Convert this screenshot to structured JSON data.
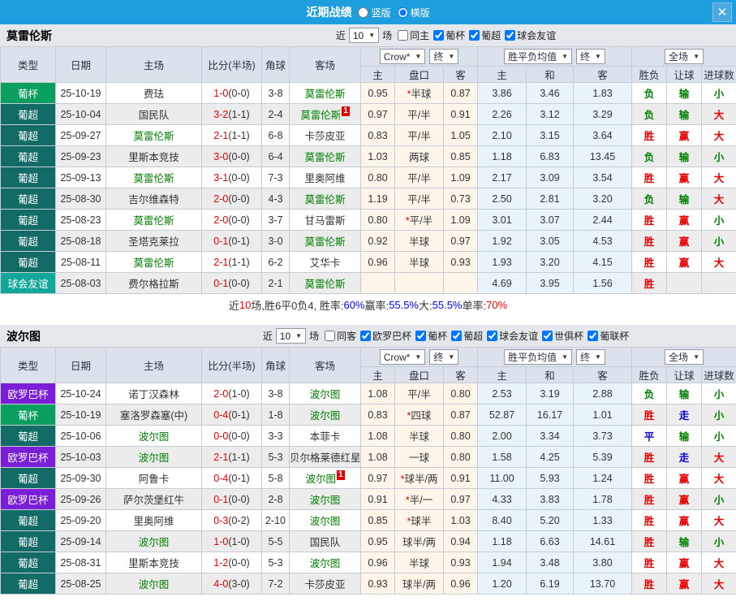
{
  "icons": {
    "dropdown_arrow": "▼"
  },
  "titlebar": {
    "title": "近期战绩",
    "vertical_label": "竖版",
    "horizontal_label": "横版",
    "selected": "横版",
    "close_label": "✕"
  },
  "header": {
    "cols": [
      "类型",
      "日期",
      "主场",
      "比分(半场)",
      "角球",
      "客场"
    ],
    "sub": [
      "主",
      "盘口",
      "客",
      "主",
      "和",
      "客",
      "胜负",
      "让球",
      "进球数"
    ],
    "dropdowns": {
      "crow": "Crow*",
      "final1": "终",
      "mean": "胜平负均值",
      "final2": "终",
      "full": "全场"
    }
  },
  "type_colors": {
    "葡杯": "#0a9f5e",
    "葡超": "#126b66",
    "球会友谊": "#13a69b",
    "欧罗巴杯": "#7a1ed8"
  },
  "result_colors": {
    "胜": "#e60000",
    "赢": "#e60000",
    "大": "#e60000",
    "负": "#008000",
    "输": "#008000",
    "小": "#008000",
    "平": "#0000dd",
    "走": "#0000dd"
  },
  "sections": [
    {
      "team": "莫雷伦斯",
      "filter": {
        "prefix": "近",
        "count": "10",
        "suffix": "场",
        "checkboxes": [
          {
            "label": "同主",
            "checked": false
          },
          {
            "label": "葡杯",
            "checked": true
          },
          {
            "label": "葡超",
            "checked": true
          },
          {
            "label": "球会友谊",
            "checked": true
          }
        ]
      },
      "rows": [
        {
          "type": "葡杯",
          "date": "25-10-19",
          "home": "费珐",
          "score": "1-0",
          "half": "(0-0)",
          "corners": "3-8",
          "away": "莫雷伦斯",
          "odds": [
            "0.95",
            "*半球",
            "0.87"
          ],
          "mean": [
            "3.86",
            "3.46",
            "1.83"
          ],
          "results": [
            "负",
            "输",
            "小"
          ]
        },
        {
          "type": "葡超",
          "date": "25-10-04",
          "home": "国民队",
          "score": "3-2",
          "half": "(1-1)",
          "corners": "2-4",
          "away": "莫雷伦斯",
          "away_badge": "1",
          "odds": [
            "0.97",
            "平/半",
            "0.91"
          ],
          "mean": [
            "2.26",
            "3.12",
            "3.29"
          ],
          "results": [
            "负",
            "输",
            "大"
          ]
        },
        {
          "type": "葡超",
          "date": "25-09-27",
          "home": "莫雷伦斯",
          "score": "2-1",
          "half": "(1-1)",
          "corners": "6-8",
          "away": "卡莎皮亚",
          "odds": [
            "0.83",
            "平/半",
            "1.05"
          ],
          "mean": [
            "2.10",
            "3.15",
            "3.64"
          ],
          "results": [
            "胜",
            "赢",
            "大"
          ]
        },
        {
          "type": "葡超",
          "date": "25-09-23",
          "home": "里斯本竞技",
          "score": "3-0",
          "half": "(0-0)",
          "corners": "6-4",
          "away": "莫雷伦斯",
          "odds": [
            "1.03",
            "两球",
            "0.85"
          ],
          "mean": [
            "1.18",
            "6.83",
            "13.45"
          ],
          "results": [
            "负",
            "输",
            "小"
          ]
        },
        {
          "type": "葡超",
          "date": "25-09-13",
          "home": "莫雷伦斯",
          "score": "3-1",
          "half": "(0-0)",
          "corners": "7-3",
          "away": "里奥阿维",
          "odds": [
            "0.80",
            "平/半",
            "1.09"
          ],
          "mean": [
            "2.17",
            "3.09",
            "3.54"
          ],
          "results": [
            "胜",
            "赢",
            "大"
          ]
        },
        {
          "type": "葡超",
          "date": "25-08-30",
          "home": "吉尔维森特",
          "score": "2-0",
          "half": "(0-0)",
          "corners": "4-3",
          "away": "莫雷伦斯",
          "odds": [
            "1.19",
            "平/半",
            "0.73"
          ],
          "mean": [
            "2.50",
            "2.81",
            "3.20"
          ],
          "results": [
            "负",
            "输",
            "大"
          ]
        },
        {
          "type": "葡超",
          "date": "25-08-23",
          "home": "莫雷伦斯",
          "score": "2-0",
          "half": "(0-0)",
          "corners": "3-7",
          "away": "甘马雷斯",
          "odds": [
            "0.80",
            "*平/半",
            "1.09"
          ],
          "mean": [
            "3.01",
            "3.07",
            "2.44"
          ],
          "results": [
            "胜",
            "赢",
            "小"
          ]
        },
        {
          "type": "葡超",
          "date": "25-08-18",
          "home": "圣塔克莱拉",
          "score": "0-1",
          "half": "(0-1)",
          "corners": "3-0",
          "away": "莫雷伦斯",
          "odds": [
            "0.92",
            "半球",
            "0.97"
          ],
          "mean": [
            "1.92",
            "3.05",
            "4.53"
          ],
          "results": [
            "胜",
            "赢",
            "小"
          ]
        },
        {
          "type": "葡超",
          "date": "25-08-11",
          "home": "莫雷伦斯",
          "score": "2-1",
          "half": "(1-1)",
          "corners": "6-2",
          "away": "艾华卡",
          "odds": [
            "0.96",
            "半球",
            "0.93"
          ],
          "mean": [
            "1.93",
            "3.20",
            "4.15"
          ],
          "results": [
            "胜",
            "赢",
            "大"
          ]
        },
        {
          "type": "球会友谊",
          "date": "25-08-03",
          "home": "费尔格拉斯",
          "score": "0-1",
          "half": "(0-0)",
          "corners": "2-1",
          "away": "莫雷伦斯",
          "odds": [
            "",
            "",
            ""
          ],
          "mean": [
            "4.69",
            "3.95",
            "1.56"
          ],
          "results": [
            "胜",
            "",
            ""
          ]
        }
      ],
      "summary": [
        {
          "t": "近",
          "c": "#333333"
        },
        {
          "t": "10",
          "c": "#ff0000"
        },
        {
          "t": "场,胜6平0负4, 胜率:",
          "c": "#333333"
        },
        {
          "t": "60%",
          "c": "#0000ff"
        },
        {
          "t": " 赢率:",
          "c": "#333333"
        },
        {
          "t": "55.5%",
          "c": "#0000ff"
        },
        {
          "t": " 大:",
          "c": "#333333"
        },
        {
          "t": "55.5%",
          "c": "#0000ff"
        },
        {
          "t": " 单率:",
          "c": "#333333"
        },
        {
          "t": "70%",
          "c": "#ff0000"
        }
      ]
    },
    {
      "team": "波尔图",
      "filter": {
        "prefix": "近",
        "count": "10",
        "suffix": "场",
        "checkboxes": [
          {
            "label": "同客",
            "checked": false
          },
          {
            "label": "欧罗巴杯",
            "checked": true
          },
          {
            "label": "葡杯",
            "checked": true
          },
          {
            "label": "葡超",
            "checked": true
          },
          {
            "label": "球会友谊",
            "checked": true
          },
          {
            "label": "世俱杯",
            "checked": true
          },
          {
            "label": "葡联杯",
            "checked": true
          }
        ]
      },
      "rows": [
        {
          "type": "欧罗巴杯",
          "date": "25-10-24",
          "home": "诺丁汉森林",
          "score": "2-0",
          "half": "(1-0)",
          "corners": "3-8",
          "away": "波尔图",
          "odds": [
            "1.08",
            "平/半",
            "0.80"
          ],
          "mean": [
            "2.53",
            "3.19",
            "2.88"
          ],
          "results": [
            "负",
            "输",
            "小"
          ]
        },
        {
          "type": "葡杯",
          "date": "25-10-19",
          "home": "塞洛罗森塞(中)",
          "score": "0-4",
          "half": "(0-1)",
          "corners": "1-8",
          "away": "波尔图",
          "odds": [
            "0.83",
            "*四球",
            "0.87"
          ],
          "mean": [
            "52.87",
            "16.17",
            "1.01"
          ],
          "results": [
            "胜",
            "走",
            "小"
          ]
        },
        {
          "type": "葡超",
          "date": "25-10-06",
          "home": "波尔图",
          "score": "0-0",
          "half": "(0-0)",
          "corners": "3-3",
          "away": "本菲卡",
          "odds": [
            "1.08",
            "半球",
            "0.80"
          ],
          "mean": [
            "2.00",
            "3.34",
            "3.73"
          ],
          "results": [
            "平",
            "输",
            "小"
          ]
        },
        {
          "type": "欧罗巴杯",
          "date": "25-10-03",
          "home": "波尔图",
          "score": "2-1",
          "half": "(1-1)",
          "corners": "5-3",
          "away": "贝尔格莱德红星",
          "odds": [
            "1.08",
            "一球",
            "0.80"
          ],
          "mean": [
            "1.58",
            "4.25",
            "5.39"
          ],
          "results": [
            "胜",
            "走",
            "大"
          ]
        },
        {
          "type": "葡超",
          "date": "25-09-30",
          "home": "阿鲁卡",
          "score": "0-4",
          "half": "(0-1)",
          "corners": "5-8",
          "away": "波尔图",
          "away_badge": "1",
          "odds": [
            "0.97",
            "*球半/两",
            "0.91"
          ],
          "mean": [
            "11.00",
            "5.93",
            "1.24"
          ],
          "results": [
            "胜",
            "赢",
            "大"
          ]
        },
        {
          "type": "欧罗巴杯",
          "date": "25-09-26",
          "home": "萨尔茨堡红牛",
          "score": "0-1",
          "half": "(0-0)",
          "corners": "2-8",
          "away": "波尔图",
          "odds": [
            "0.91",
            "*半/一",
            "0.97"
          ],
          "mean": [
            "4.33",
            "3.83",
            "1.78"
          ],
          "results": [
            "胜",
            "赢",
            "小"
          ]
        },
        {
          "type": "葡超",
          "date": "25-09-20",
          "home": "里奥阿维",
          "score": "0-3",
          "half": "(0-2)",
          "corners": "2-10",
          "away": "波尔图",
          "odds": [
            "0.85",
            "*球半",
            "1.03"
          ],
          "mean": [
            "8.40",
            "5.20",
            "1.33"
          ],
          "results": [
            "胜",
            "赢",
            "大"
          ]
        },
        {
          "type": "葡超",
          "date": "25-09-14",
          "home": "波尔图",
          "score": "1-0",
          "half": "(1-0)",
          "corners": "5-5",
          "away": "国民队",
          "odds": [
            "0.95",
            "球半/两",
            "0.94"
          ],
          "mean": [
            "1.18",
            "6.63",
            "14.61"
          ],
          "results": [
            "胜",
            "输",
            "小"
          ]
        },
        {
          "type": "葡超",
          "date": "25-08-31",
          "home": "里斯本竞技",
          "score": "1-2",
          "half": "(0-0)",
          "corners": "5-3",
          "away": "波尔图",
          "odds": [
            "0.96",
            "半球",
            "0.93"
          ],
          "mean": [
            "1.94",
            "3.48",
            "3.80"
          ],
          "results": [
            "胜",
            "赢",
            "大"
          ]
        },
        {
          "type": "葡超",
          "date": "25-08-25",
          "home": "波尔图",
          "score": "4-0",
          "half": "(3-0)",
          "corners": "7-2",
          "away": "卡莎皮亚",
          "odds": [
            "0.93",
            "球半/两",
            "0.96"
          ],
          "mean": [
            "1.20",
            "6.19",
            "13.70"
          ],
          "results": [
            "胜",
            "赢",
            "大"
          ]
        }
      ]
    }
  ]
}
